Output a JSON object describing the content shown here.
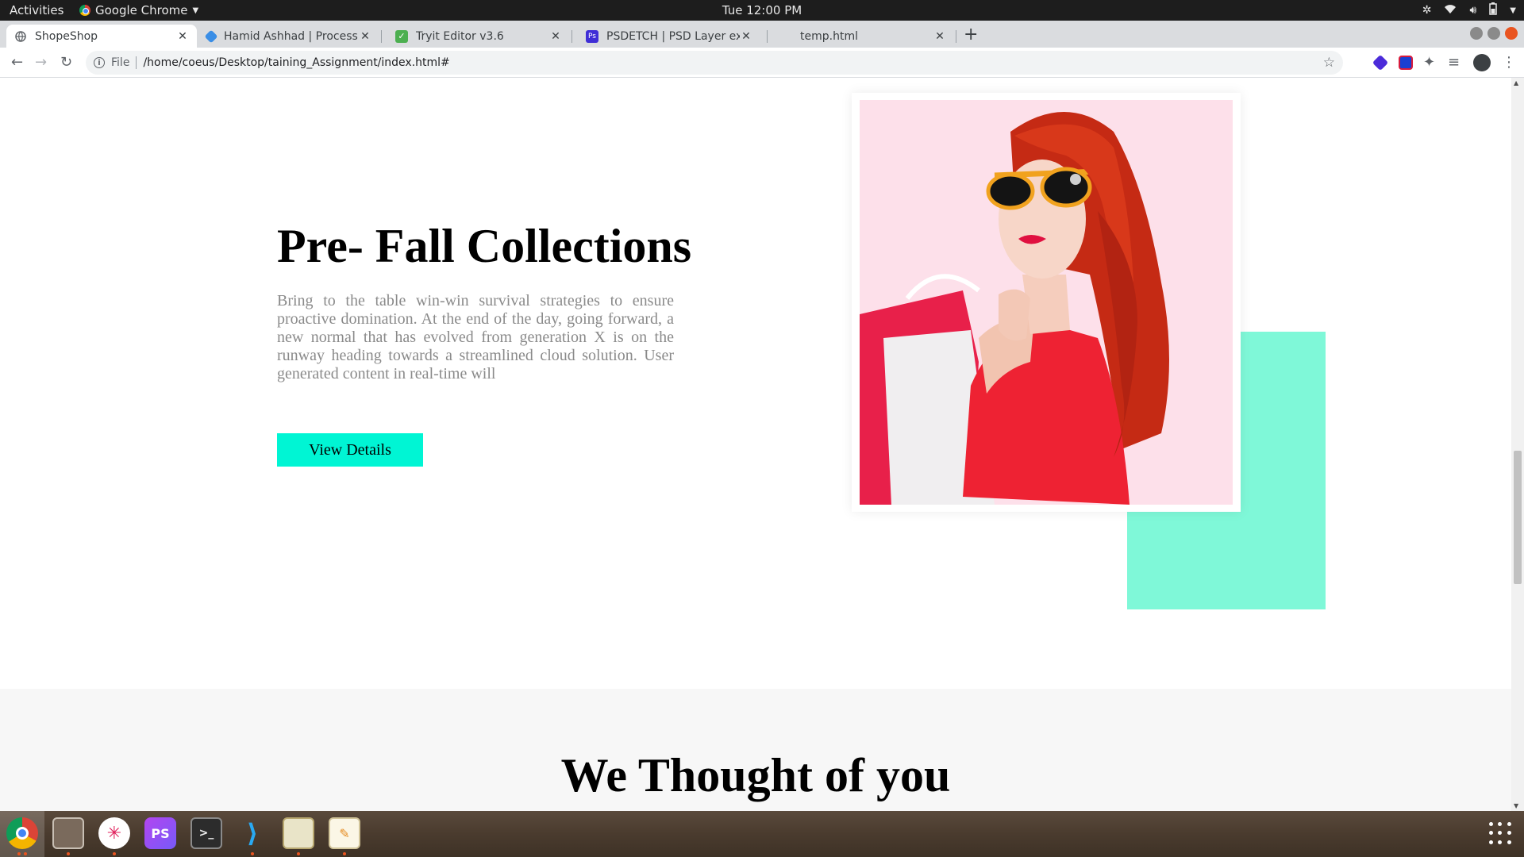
{
  "system_bar": {
    "activities": "Activities",
    "app_name": "Google Chrome",
    "clock": "Tue 12:00 PM"
  },
  "tabs": [
    {
      "title": "ShopeShop",
      "icon": "globe-icon",
      "active": true
    },
    {
      "title": "Hamid Ashhad | Process St",
      "icon": "process-street-icon",
      "active": false
    },
    {
      "title": "Tryit Editor v3.6",
      "icon": "tryit-editor-icon",
      "active": false
    },
    {
      "title": "PSDETCH | PSD Layer exp",
      "icon": "psdetch-icon",
      "active": false
    },
    {
      "title": "temp.html",
      "icon": "blank-page-icon",
      "active": false
    }
  ],
  "address_bar": {
    "scheme": "File",
    "url": "/home/coeus/Desktop/taining_Assignment/index.html#"
  },
  "hero": {
    "title": "Pre- Fall Collections",
    "body": "Bring to the table win-win survival strategies to ensure proactive domination. At the end of the day, going forward, a new normal that has evolved from generation X is on the runway heading towards a streamlined cloud solution. User generated content in real-time will",
    "button": "View Details",
    "accent_color": "#00f5d4",
    "block_color": "#7ff8d8"
  },
  "section2": {
    "title": "We Thought of you"
  },
  "dock": {
    "apps": [
      "chrome-icon",
      "files-icon",
      "slack-icon",
      "phpstorm-icon",
      "terminal-icon",
      "vscode-icon",
      "image-viewer-icon",
      "text-editor-icon"
    ],
    "phpstorm_label": "PS"
  }
}
